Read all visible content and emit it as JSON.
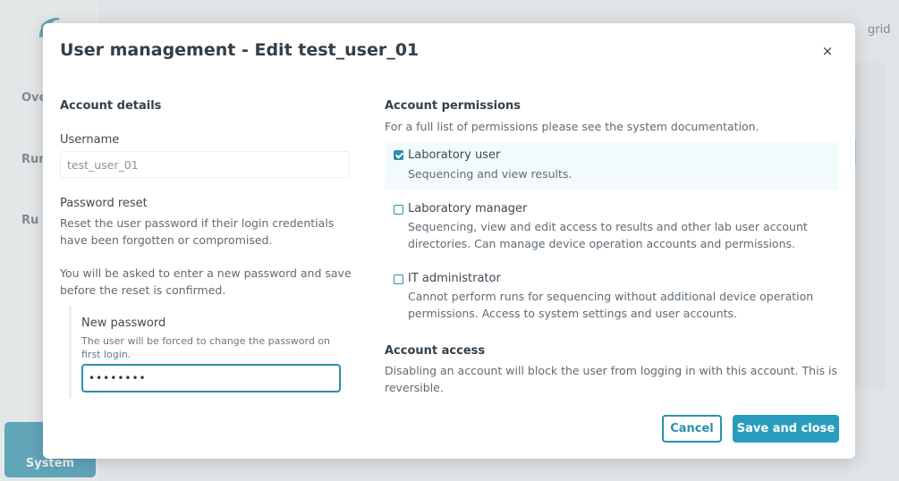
{
  "background": {
    "nav": [
      "Ove",
      "Run",
      "Ru"
    ],
    "system_label": "System",
    "top_right": "grid"
  },
  "modal": {
    "title": "User management - Edit test_user_01",
    "close_glyph": "×",
    "account_details": {
      "heading": "Account details",
      "username_label": "Username",
      "username_value": "test_user_01",
      "password_reset_label": "Password reset",
      "password_reset_text": "Reset the user password if their login credentials have been forgotten or compromised.",
      "password_reset_text_line1": "Reset the user password if their login credentials",
      "password_reset_text_line2": "have been forgotten or compromised.",
      "confirm_text_line1": "You will be asked to enter a new password and save",
      "confirm_text_line2": "before the reset is confirmed.",
      "new_password_label": "New password",
      "new_password_hint_line1": "The user will be forced to change the password on",
      "new_password_hint_line2": "first login.",
      "new_password_value": "••••••••"
    },
    "account_permissions": {
      "heading": "Account permissions",
      "subtitle": "For a full list of permissions please see the system documentation.",
      "items": [
        {
          "label": "Laboratory user",
          "checked": true,
          "desc_line1": "Sequencing and view results.",
          "desc_line2": ""
        },
        {
          "label": "Laboratory manager",
          "checked": false,
          "desc_line1": "Sequencing, view and edit access to results and other lab user account",
          "desc_line2": "directories. Can manage device operation accounts and permissions."
        },
        {
          "label": "IT administrator",
          "checked": false,
          "desc_line1": "Cannot perform runs for sequencing without additional device operation",
          "desc_line2": "permissions. Access to system settings and user accounts."
        }
      ]
    },
    "account_access": {
      "heading": "Account access",
      "text_line1": "Disabling an account will block the user from logging in with this account. This is",
      "text_line2": "reversible."
    },
    "buttons": {
      "cancel": "Cancel",
      "save": "Save and close"
    }
  },
  "colors": {
    "accent": "#2a8fad",
    "save_bg": "#2a9dbf"
  }
}
